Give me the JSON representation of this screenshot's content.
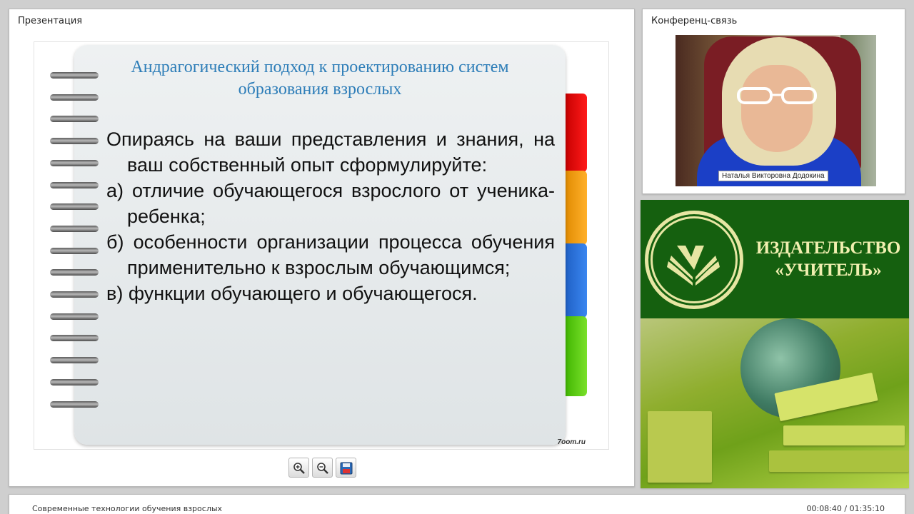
{
  "presentation": {
    "title": "Презентация",
    "slide": {
      "title_line1": "Андрагогический подход к проектированию систем",
      "title_line2": "образования взрослых",
      "intro": "Опираясь на ваши представления и знания, на ваш собственный опыт сформулируйте:",
      "item_a": "а) отличие обучающегося взрослого от ученика-ребенка;",
      "item_b": "б) особенности организации процесса обучения применительно к взрослым обучающимся;",
      "item_c": "в) функции обучающего и обучающегося.",
      "watermark": "7oom.ru",
      "tab_colors": [
        "#e00000",
        "#ffa31a",
        "#2e74e0",
        "#5fcf10"
      ]
    },
    "toolbar": {
      "zoom_in_icon": "zoom-in-icon",
      "zoom_out_icon": "zoom-out-icon",
      "save_icon": "save-icon"
    }
  },
  "conference": {
    "title": "Конференц-связь",
    "speaker_name": "Наталья Викторовна Додокина"
  },
  "banner": {
    "line1": "ИЗДАТЕЛЬСТВО",
    "line2": "«УЧИТЕЛЬ»",
    "brand_color": "#15600f",
    "text_color": "#f1efb0"
  },
  "footer": {
    "course_title": "Современные технологии обучения взрослых",
    "time": "00:08:40 / 01:35:10"
  }
}
